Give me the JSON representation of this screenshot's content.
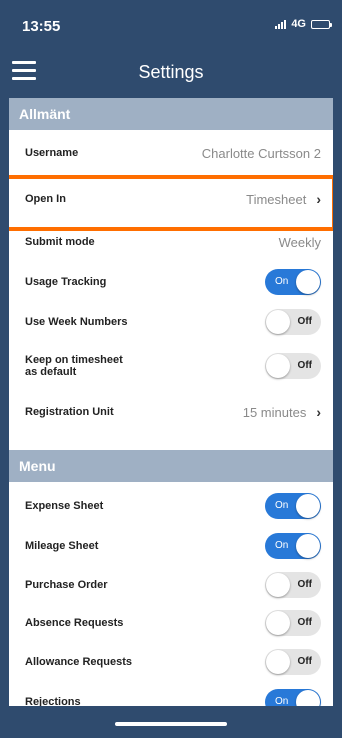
{
  "status_bar": {
    "time": "13:55",
    "network": "4G"
  },
  "nav": {
    "title": "Settings"
  },
  "sections": {
    "general": {
      "header": "Allmänt",
      "username": {
        "label": "Username",
        "value": "Charlotte Curtsson 2"
      },
      "open_in": {
        "label": "Open In",
        "value": "Timesheet"
      },
      "submit_mode": {
        "label": "Submit mode",
        "value": "Weekly"
      },
      "usage_tracking": {
        "label": "Usage Tracking",
        "state": "On"
      },
      "use_week_numbers": {
        "label": "Use Week Numbers",
        "state": "Off"
      },
      "keep_on_timesheet": {
        "label_line1": "Keep on timesheet",
        "label_line2": "as default",
        "state": "Off"
      },
      "registration_unit": {
        "label": "Registration Unit",
        "value": "15 minutes"
      }
    },
    "menu": {
      "header": "Menu",
      "items": [
        {
          "label": "Expense Sheet",
          "state": "On"
        },
        {
          "label": "Mileage Sheet",
          "state": "On"
        },
        {
          "label": "Purchase Order",
          "state": "Off"
        },
        {
          "label": "Absence Requests",
          "state": "Off"
        },
        {
          "label": "Allowance Requests",
          "state": "Off"
        },
        {
          "label": "Rejections",
          "state": "On"
        }
      ]
    }
  },
  "colors": {
    "nav_bg": "#2f4b6e",
    "section_header": "#9fb0c4",
    "toggle_on": "#2879d8",
    "highlight": "#ff6e00"
  }
}
